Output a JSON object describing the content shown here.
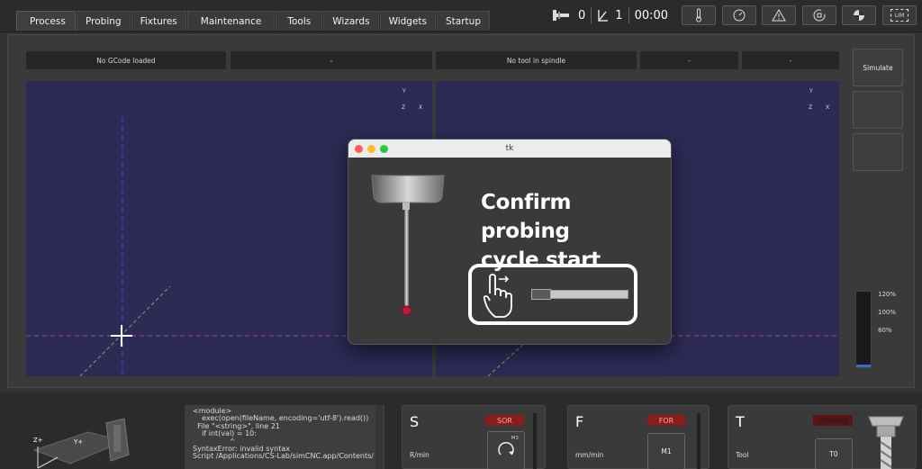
{
  "tabs": [
    "Process",
    "Probing",
    "Fixtures",
    "Maintenance",
    "Tools",
    "Wizards",
    "Widgets",
    "Startup"
  ],
  "counters": {
    "tool_count": "0",
    "line_count": "1",
    "time": "00:00"
  },
  "top_buttons": [
    "thermometer-icon",
    "gauge-icon",
    "warning-icon",
    "spindle-speed-icon",
    "estop-icon",
    "limit-icon"
  ],
  "top_buttons_text": {
    "limit": "LIM"
  },
  "info_bar": {
    "gcode": "No GCode loaded",
    "field2": "-",
    "tool": "No tool in spindle",
    "field4": "-",
    "field5": "-"
  },
  "side_buttons": {
    "simulate": "Simulate"
  },
  "axis_labels": {
    "y": "Y",
    "z": "Z",
    "x": "X"
  },
  "overrides": [
    "120%",
    "100%",
    "80%"
  ],
  "console_text": "<module>\n    exec(open(fileName, encoding='utf-8').read())\n  File \"<string>\", line 21\n    if int(val) = 10:\n                ^\nSyntaxError: invalid syntax\nScript /Applications/CS-Lab/simCNC.app/Contents/",
  "spindle": {
    "label": "S",
    "unit": "R/min",
    "badge": "SOR",
    "dir": "M3"
  },
  "feed": {
    "label": "F",
    "unit": "mm/min",
    "badge": "FOR",
    "button": "M1"
  },
  "tool": {
    "label": "T",
    "unit": "Tool",
    "badge": "CHANGE",
    "button": "T0"
  },
  "machine_axes": {
    "z": "Z+",
    "y": "Y+"
  },
  "dialog": {
    "title": "tk",
    "line1": "Confirm probing",
    "line2": "cycle start"
  },
  "colors": {
    "viewport": "#2b2b55",
    "accent_red": "#8a1c1c",
    "probe_ball": "#c0183a"
  }
}
